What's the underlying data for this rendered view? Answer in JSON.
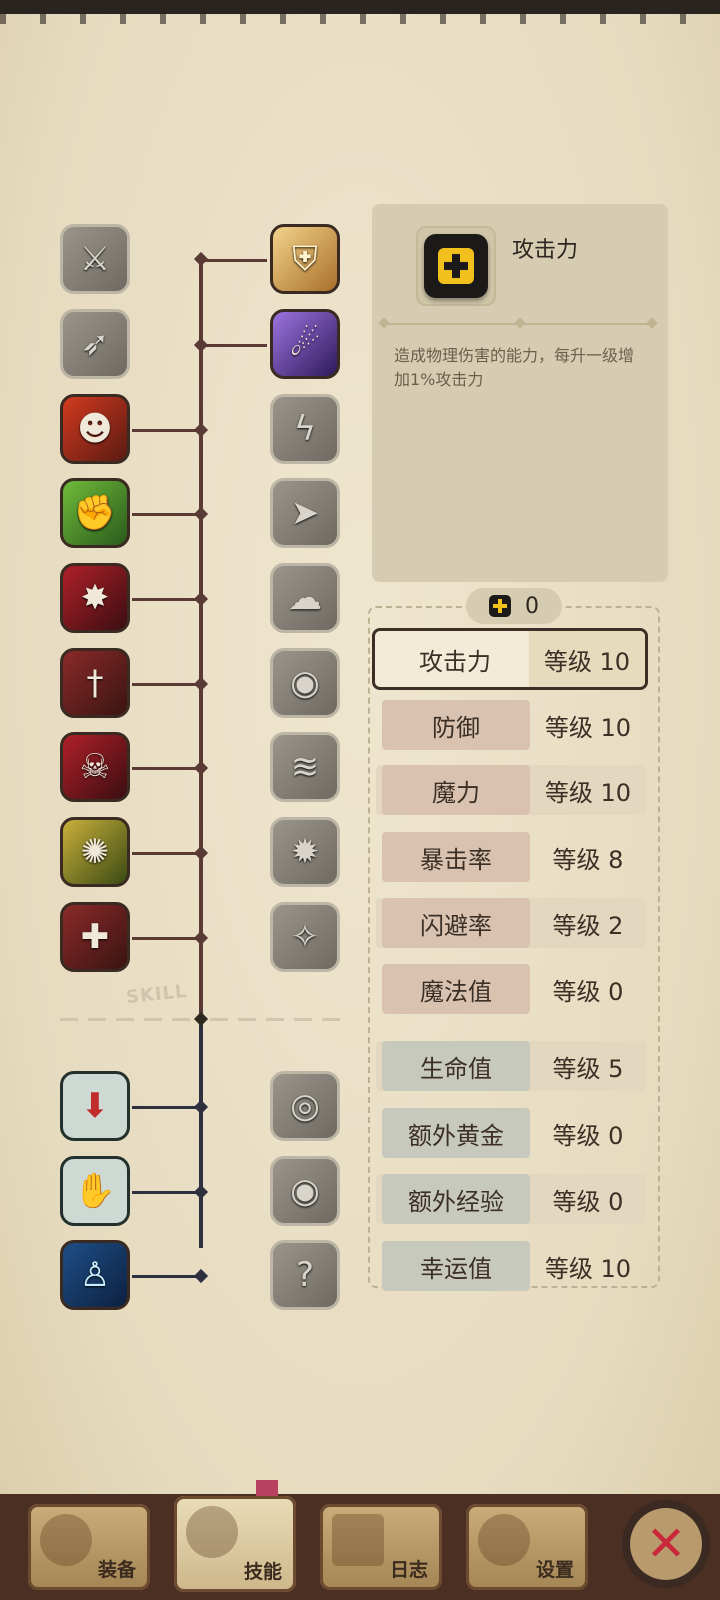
{
  "skill_tree": {
    "label": "SKILL",
    "left_column": [
      {
        "icon": "slash-icon",
        "state": "inactive"
      },
      {
        "icon": "sprint-icon",
        "state": "inactive"
      },
      {
        "icon": "rage-icon",
        "state": "active"
      },
      {
        "icon": "strength-icon",
        "state": "active"
      },
      {
        "icon": "burst-icon",
        "state": "active"
      },
      {
        "icon": "dagger-icon",
        "state": "active"
      },
      {
        "icon": "ninja-icon",
        "state": "active"
      },
      {
        "icon": "fury-icon",
        "state": "active"
      },
      {
        "icon": "sword-icon",
        "state": "active"
      },
      {
        "icon": "trap-icon",
        "state": "active"
      },
      {
        "icon": "chest-hand-icon",
        "state": "active"
      },
      {
        "icon": "aura-icon",
        "state": "active"
      }
    ],
    "right_column": [
      {
        "icon": "shield-cross-icon",
        "state": "active"
      },
      {
        "icon": "shadow-strike-icon",
        "state": "active"
      },
      {
        "icon": "lightning-icon",
        "state": "inactive"
      },
      {
        "icon": "dash-icon",
        "state": "inactive"
      },
      {
        "icon": "smoke-icon",
        "state": "inactive"
      },
      {
        "icon": "stone-icon",
        "state": "inactive"
      },
      {
        "icon": "whirl-icon",
        "state": "inactive"
      },
      {
        "icon": "vortex-icon",
        "state": "inactive"
      },
      {
        "icon": "sparkle-icon",
        "state": "inactive"
      },
      {
        "icon": "eye-trap-icon",
        "state": "inactive"
      },
      {
        "icon": "eye-chest-icon",
        "state": "inactive"
      },
      {
        "icon": "luck-icon",
        "state": "inactive"
      }
    ]
  },
  "info": {
    "title": "攻击力",
    "description": "造成物理伤害的能力，每升一级增加1%攻击力",
    "icon": "plus-icon"
  },
  "points": {
    "value": "0",
    "icon": "plus-icon"
  },
  "stats": [
    {
      "name": "攻击力",
      "level": "等级 10",
      "selected": true,
      "group": "warm"
    },
    {
      "name": "防御",
      "level": "等级 10",
      "group": "warm"
    },
    {
      "name": "魔力",
      "level": "等级 10",
      "group": "warm"
    },
    {
      "name": "暴击率",
      "level": "等级 8",
      "group": "warm"
    },
    {
      "name": "闪避率",
      "level": "等级 2",
      "group": "warm"
    },
    {
      "name": "魔法值",
      "level": "等级 0",
      "group": "warm"
    },
    {
      "name": "生命值",
      "level": "等级 5",
      "group": "cool"
    },
    {
      "name": "额外黄金",
      "level": "等级 0",
      "group": "cool"
    },
    {
      "name": "额外经验",
      "level": "等级 0",
      "group": "cool"
    },
    {
      "name": "幸运值",
      "level": "等级 10",
      "group": "cool"
    }
  ],
  "nav": {
    "tabs": [
      {
        "label": "装备",
        "icon": "axe-icon"
      },
      {
        "label": "技能",
        "icon": "gear-star-icon",
        "active": true
      },
      {
        "label": "日志",
        "icon": "book-icon"
      },
      {
        "label": "设置",
        "icon": "gear-icon"
      }
    ],
    "close_icon": "close-icon"
  },
  "colors": {
    "parchment": "#ece3cc",
    "accent_gold": "#f2c01c",
    "close_red": "#c8283a",
    "tree_line_top": "#5a3a34",
    "tree_line_bottom": "#2e3040"
  }
}
